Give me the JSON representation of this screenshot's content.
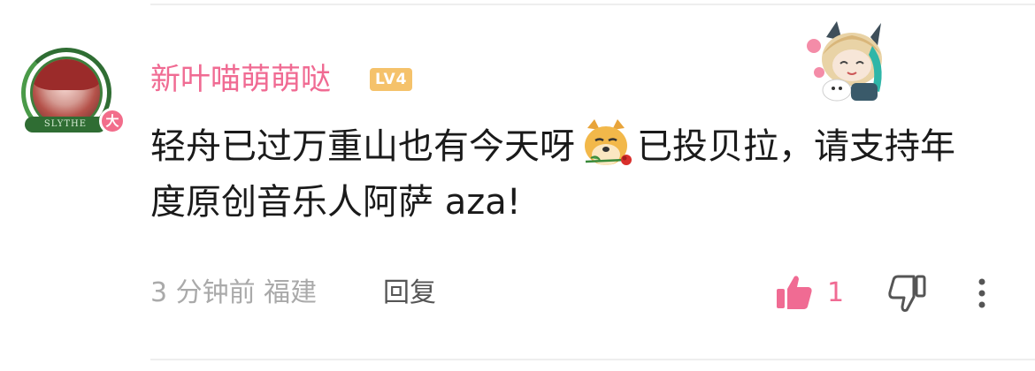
{
  "comment": {
    "username": "新叶喵萌萌哒",
    "level": "LV4",
    "vip_badge": "大",
    "avatar_ribbon": "SLYTHE",
    "text_before_emoji": "轻舟已过万重山也有今天呀",
    "emoji": "doge-with-rose-icon",
    "text_after_emoji": "已投贝拉，请支持年度原创音乐人阿萨 aza!",
    "time_location": "3 分钟前 福建",
    "reply_label": "回复",
    "like_count": "1"
  },
  "colors": {
    "username": "#f06b93",
    "level_badge": "#f5c26b",
    "like_active": "#f06b93",
    "meta_text": "#aaaaaa"
  }
}
